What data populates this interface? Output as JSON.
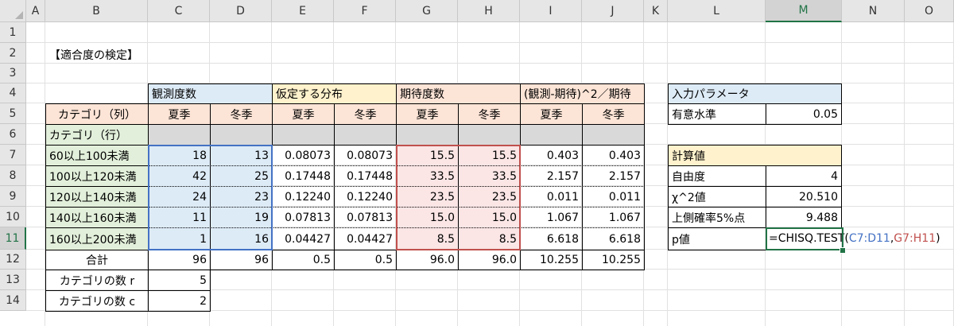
{
  "columns": [
    "A",
    "B",
    "C",
    "D",
    "E",
    "F",
    "G",
    "H",
    "I",
    "J",
    "K",
    "L",
    "M",
    "N",
    "O"
  ],
  "rows": [
    "1",
    "2",
    "3",
    "4",
    "5",
    "6",
    "7",
    "8",
    "9",
    "10",
    "11",
    "12",
    "13",
    "14"
  ],
  "title": "【適合度の検定】",
  "groups": {
    "observed": "観測度数",
    "assumed": "仮定する分布",
    "expected": "期待度数",
    "chi": "(観測-期待)^2／期待"
  },
  "col_category": "カテゴリ（列）",
  "row_category": "カテゴリ（行）",
  "season_summer": "夏季",
  "season_winter": "冬季",
  "data_rows": [
    {
      "label": "60以上100未満",
      "c": "18",
      "d": "13",
      "e": "0.08073",
      "f": "0.08073",
      "g": "15.5",
      "h": "15.5",
      "i": "0.403",
      "j": "0.403"
    },
    {
      "label": "100以上120未満",
      "c": "42",
      "d": "25",
      "e": "0.17448",
      "f": "0.17448",
      "g": "33.5",
      "h": "33.5",
      "i": "2.157",
      "j": "2.157"
    },
    {
      "label": "120以上140未満",
      "c": "24",
      "d": "23",
      "e": "0.12240",
      "f": "0.12240",
      "g": "23.5",
      "h": "23.5",
      "i": "0.011",
      "j": "0.011"
    },
    {
      "label": "140以上160未満",
      "c": "11",
      "d": "19",
      "e": "0.07813",
      "f": "0.07813",
      "g": "15.0",
      "h": "15.0",
      "i": "1.067",
      "j": "1.067"
    },
    {
      "label": "160以上200未満",
      "c": "1",
      "d": "16",
      "e": "0.04427",
      "f": "0.04427",
      "g": "8.5",
      "h": "8.5",
      "i": "6.618",
      "j": "6.618"
    }
  ],
  "total": {
    "label": "合計",
    "c": "96",
    "d": "96",
    "e": "0.5",
    "f": "0.5",
    "g": "96.0",
    "h": "96.0",
    "i": "10.255",
    "j": "10.255"
  },
  "count_r": {
    "label": "カテゴリの数 r",
    "value": "5"
  },
  "count_c": {
    "label": "カテゴリの数 c",
    "value": "2"
  },
  "params": {
    "header": "入力パラメータ",
    "alpha_label": "有意水準",
    "alpha_value": "0.05"
  },
  "calc": {
    "header": "計算値",
    "df_label": "自由度",
    "df_value": "4",
    "chi2_label": "χ^2値",
    "chi2_value": "20.510",
    "crit_label": "上側確率5%点",
    "crit_value": "9.488",
    "p_label": "p値",
    "formula_prefix": "=CHISQ.TEST(",
    "formula_ref1": "C7:D11",
    "formula_sep": ",",
    "formula_ref2": "G7:H11",
    "formula_suffix": ")"
  },
  "colors": {
    "observed_blue": "#ddebf7",
    "assumed_yellow": "#fff2cc",
    "peach": "#fce4d6",
    "green": "#e2efda",
    "select_green": "#217346",
    "ref_blue": "#4472c4",
    "ref_red": "#c0504d"
  }
}
